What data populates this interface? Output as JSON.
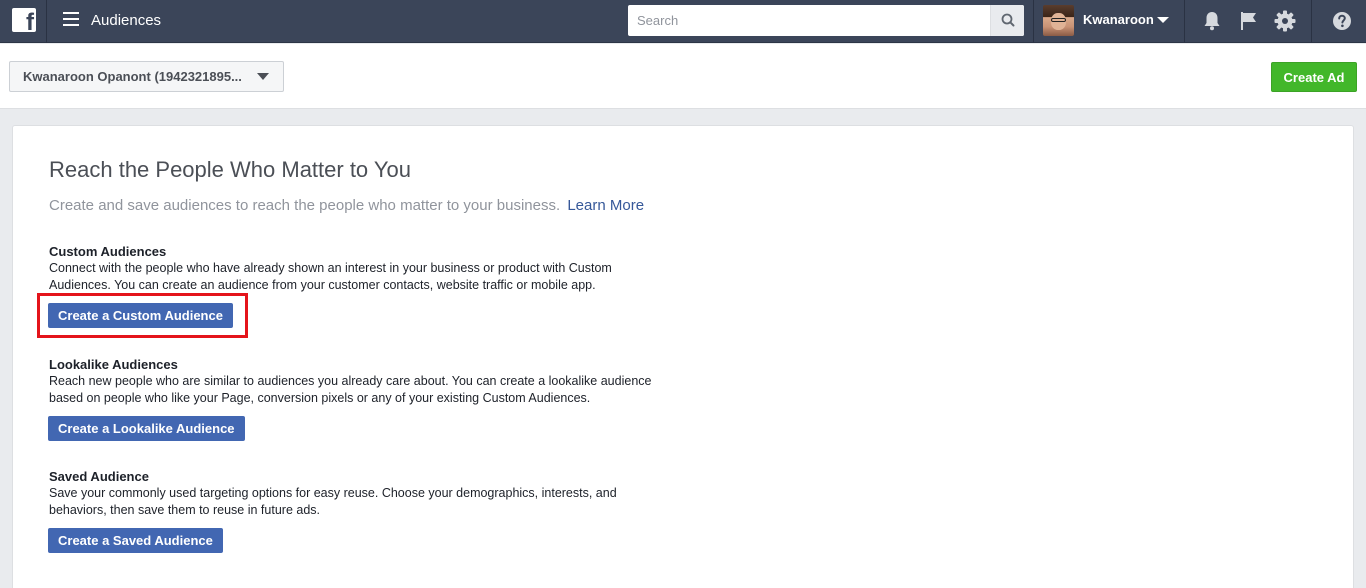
{
  "topbar": {
    "app_title": "Audiences",
    "search_placeholder": "Search",
    "user_name": "Kwanaroon",
    "logo_letter": "f"
  },
  "subheader": {
    "account_label": "Kwanaroon Opanont (1942321895...",
    "create_ad_label": "Create Ad"
  },
  "main": {
    "title": "Reach the People Who Matter to You",
    "subtitle": "Create and save audiences to reach the people who matter to your business.",
    "learn_more": "Learn More",
    "sections": [
      {
        "heading": "Custom Audiences",
        "description_line1": "Connect with the people who have already shown an interest in your business or product with Custom",
        "description_line2": "Audiences. You can create an audience from your customer contacts, website traffic or mobile app.",
        "button_label": "Create a Custom Audience"
      },
      {
        "heading": "Lookalike Audiences",
        "description_line1": "Reach new people who are similar to audiences you already care about. You can create a lookalike audience",
        "description_line2": "based on people who like your Page, conversion pixels or any of your existing Custom Audiences.",
        "button_label": "Create a Lookalike Audience"
      },
      {
        "heading": "Saved Audience",
        "description_line1": "Save your commonly used targeting options for easy reuse. Choose your demographics, interests, and",
        "description_line2": "behaviors, then save them to reuse in future ads.",
        "button_label": "Create a Saved Audience"
      }
    ]
  },
  "colors": {
    "topbar": "#3b4559",
    "primary_button": "#4267b2",
    "create_ad_button": "#42b72a",
    "highlight": "#e4141b",
    "link": "#365899"
  },
  "icons": [
    "facebook-logo-icon",
    "hamburger-menu-icon",
    "search-icon",
    "chevron-down-icon",
    "bell-icon",
    "flag-icon",
    "gear-icon",
    "help-icon"
  ]
}
